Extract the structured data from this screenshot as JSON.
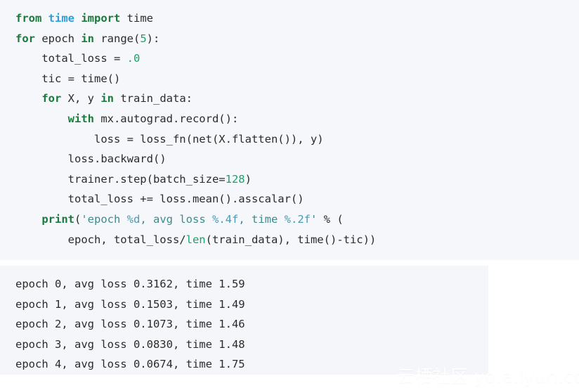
{
  "code_cell": {
    "background": "#f6f7fa",
    "language": "python",
    "lines": [
      [
        {
          "t": "from",
          "c": "kw"
        },
        {
          "t": " ",
          "c": "pl"
        },
        {
          "t": "time",
          "c": "mod"
        },
        {
          "t": " ",
          "c": "pl"
        },
        {
          "t": "import",
          "c": "kw"
        },
        {
          "t": " time",
          "c": "pl"
        }
      ],
      [
        {
          "t": "for",
          "c": "kw"
        },
        {
          "t": " epoch ",
          "c": "pl"
        },
        {
          "t": "in",
          "c": "kw"
        },
        {
          "t": " range(",
          "c": "pl"
        },
        {
          "t": "5",
          "c": "num"
        },
        {
          "t": "):",
          "c": "pl"
        }
      ],
      [
        {
          "t": "    total_loss = ",
          "c": "pl"
        },
        {
          "t": ".0",
          "c": "num"
        }
      ],
      [
        {
          "t": "    tic = time()",
          "c": "pl"
        }
      ],
      [
        {
          "t": "    ",
          "c": "pl"
        },
        {
          "t": "for",
          "c": "kw"
        },
        {
          "t": " X, y ",
          "c": "pl"
        },
        {
          "t": "in",
          "c": "kw"
        },
        {
          "t": " train_data:",
          "c": "pl"
        }
      ],
      [
        {
          "t": "        ",
          "c": "pl"
        },
        {
          "t": "with",
          "c": "kw"
        },
        {
          "t": " mx.autograd.record():",
          "c": "pl"
        }
      ],
      [
        {
          "t": "            loss = loss_fn(net(X.flatten()), y)",
          "c": "pl"
        }
      ],
      [
        {
          "t": "        loss.backward()",
          "c": "pl"
        }
      ],
      [
        {
          "t": "        trainer.step(batch_size=",
          "c": "pl"
        },
        {
          "t": "128",
          "c": "num"
        },
        {
          "t": ")",
          "c": "pl"
        }
      ],
      [
        {
          "t": "        total_loss += loss.mean().asscalar()",
          "c": "pl"
        }
      ],
      [
        {
          "t": "    ",
          "c": "pl"
        },
        {
          "t": "print",
          "c": "kw"
        },
        {
          "t": "(",
          "c": "pl"
        },
        {
          "t": "'epoch ",
          "c": "str"
        },
        {
          "t": "%d",
          "c": "fmt"
        },
        {
          "t": ", avg loss ",
          "c": "str"
        },
        {
          "t": "%.4f",
          "c": "fmt"
        },
        {
          "t": ", time ",
          "c": "str"
        },
        {
          "t": "%.2f",
          "c": "fmt"
        },
        {
          "t": "'",
          "c": "str"
        },
        {
          "t": " % (",
          "c": "pl"
        }
      ],
      [
        {
          "t": "        epoch, total_loss/",
          "c": "pl"
        },
        {
          "t": "len",
          "c": "bi"
        },
        {
          "t": "(train_data), time()-tic))",
          "c": "pl"
        }
      ]
    ],
    "plain_text": "from time import time\nfor epoch in range(5):\n    total_loss = .0\n    tic = time()\n    for X, y in train_data:\n        with mx.autograd.record():\n            loss = loss_fn(net(X.flatten()), y)\n        loss.backward()\n        trainer.step(batch_size=128)\n        total_loss += loss.mean().asscalar()\n    print('epoch %d, avg loss %.4f, time %.2f' % (\n        epoch, total_loss/len(train_data), time()-tic))"
  },
  "output_cell": {
    "background": "#f5f6f9",
    "lines": [
      "epoch 0, avg loss 0.3162, time 1.59",
      "epoch 1, avg loss 0.1503, time 1.49",
      "epoch 2, avg loss 0.1073, time 1.46",
      "epoch 3, avg loss 0.0830, time 1.48",
      "epoch 4, avg loss 0.0674, time 1.75"
    ],
    "records": [
      {
        "epoch": "0",
        "avg_loss": "0.3162",
        "time": "1.59"
      },
      {
        "epoch": "1",
        "avg_loss": "0.1503",
        "time": "1.49"
      },
      {
        "epoch": "2",
        "avg_loss": "0.1073",
        "time": "1.46"
      },
      {
        "epoch": "3",
        "avg_loss": "0.0830",
        "time": "1.48"
      },
      {
        "epoch": "4",
        "avg_loss": "0.0674",
        "time": "1.75"
      }
    ]
  },
  "watermark": {
    "cn": "云栖社区",
    "url": "yq.aliyun.com"
  }
}
